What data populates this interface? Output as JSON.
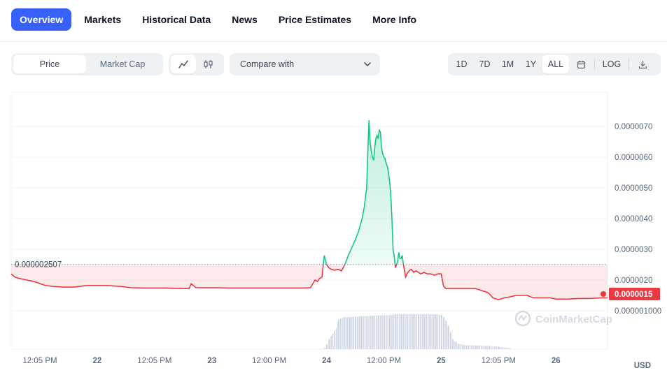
{
  "nav": {
    "tabs": [
      {
        "label": "Overview",
        "active": true
      },
      {
        "label": "Markets"
      },
      {
        "label": "Historical Data"
      },
      {
        "label": "News"
      },
      {
        "label": "Price Estimates"
      },
      {
        "label": "More Info"
      }
    ]
  },
  "toolbar": {
    "metric": {
      "price": "Price",
      "market_cap": "Market Cap",
      "selected": "Price"
    },
    "chart_type": {
      "line_icon": "line-chart-icon",
      "candle_icon": "candlestick-icon",
      "selected": "line"
    },
    "compare": {
      "label": "Compare with",
      "icon": "chevron-down-icon"
    },
    "ranges": [
      "1D",
      "7D",
      "1M",
      "1Y",
      "ALL"
    ],
    "selected_range": "ALL",
    "calendar_icon": "calendar-icon",
    "log_label": "LOG",
    "download_icon": "download-icon"
  },
  "chart_data": {
    "type": "area",
    "ylim": [
      1e-06,
      7.5e-06
    ],
    "y_ticks": [
      "0.0000070",
      "0.0000060",
      "0.0000050",
      "0.0000040",
      "0.0000030",
      "0.0000020",
      "0.000001000"
    ],
    "y_tick_values": [
      7e-06,
      6e-06,
      5e-06,
      4e-06,
      3e-06,
      2e-06,
      1e-06
    ],
    "x_ticks": [
      "12:05 PM",
      "22",
      "12:05 PM",
      "23",
      "12:00 PM",
      "24",
      "12:00 PM",
      "25",
      "12:05 PM",
      "26"
    ],
    "x_tick_positions": [
      0.5,
      1,
      1.5,
      2,
      2.5,
      3,
      3.5,
      4,
      4.5,
      5
    ],
    "x_range": [
      0.25,
      5.45
    ],
    "reference_price": 2.507e-06,
    "reference_label": "0.000002507",
    "current_price": 1.5e-06,
    "current_label": "0.0000015",
    "currency": "USD",
    "watermark": "CoinMarketCap",
    "colors": {
      "up": "#16c784",
      "down": "#ea3943",
      "volume": "#cfd6e4"
    },
    "series": [
      {
        "x": [
          0.25,
          0.28,
          0.32,
          0.36,
          0.45,
          0.55,
          0.62,
          0.7,
          0.8,
          0.9,
          1.0,
          1.1,
          1.2,
          1.3,
          1.4,
          1.5,
          1.6,
          1.7,
          1.8,
          1.82,
          1.86,
          1.95,
          2.05,
          2.15,
          2.3,
          2.45,
          2.6,
          2.7,
          2.8,
          2.86,
          2.9,
          2.92,
          2.94,
          2.96,
          2.98,
          3.0,
          3.02,
          3.04,
          3.07,
          3.1,
          3.13,
          3.16,
          3.19,
          3.22,
          3.25,
          3.28,
          3.31,
          3.33,
          3.35,
          3.36,
          3.37,
          3.38,
          3.39,
          3.4,
          3.41,
          3.42,
          3.43,
          3.44,
          3.45,
          3.46,
          3.47,
          3.48,
          3.49,
          3.5,
          3.51,
          3.52,
          3.53,
          3.54,
          3.55,
          3.56,
          3.57,
          3.58,
          3.59,
          3.6,
          3.61,
          3.62,
          3.63,
          3.64,
          3.65,
          3.66,
          3.67,
          3.68,
          3.69,
          3.7,
          3.72,
          3.74,
          3.76,
          3.78,
          3.8,
          3.82,
          3.85,
          3.88,
          3.91,
          3.94,
          3.97,
          4.0,
          4.02,
          4.04,
          4.06,
          4.1,
          4.2,
          4.3,
          4.4,
          4.42,
          4.45,
          4.5,
          4.55,
          4.6,
          4.65,
          4.7,
          4.75,
          4.8,
          4.85,
          4.9,
          4.95,
          5.0,
          5.1,
          5.2,
          5.3,
          5.4,
          5.45
        ],
        "values": [
          2.2,
          2.1,
          2.05,
          2.02,
          1.95,
          1.82,
          1.79,
          1.77,
          1.77,
          1.82,
          1.82,
          1.82,
          1.79,
          1.75,
          1.74,
          1.74,
          1.74,
          1.73,
          1.72,
          1.88,
          1.75,
          1.75,
          1.75,
          1.74,
          1.74,
          1.74,
          1.74,
          1.74,
          1.74,
          1.75,
          2.0,
          1.95,
          2.05,
          2.1,
          2.8,
          2.5,
          2.4,
          2.35,
          2.32,
          2.35,
          2.3,
          2.5,
          2.8,
          3.05,
          3.3,
          3.6,
          4.0,
          4.4,
          5.0,
          6.2,
          7.2,
          6.5,
          6.2,
          6.0,
          5.9,
          6.3,
          6.6,
          6.7,
          6.6,
          6.9,
          6.8,
          6.3,
          6.1,
          6.0,
          5.95,
          5.8,
          5.7,
          5.5,
          5.2,
          4.8,
          4.0,
          3.0,
          2.8,
          2.4,
          2.5,
          2.6,
          2.9,
          2.7,
          2.7,
          2.8,
          2.5,
          2.3,
          2.1,
          2.2,
          2.3,
          2.35,
          2.25,
          2.3,
          2.25,
          2.2,
          2.25,
          2.2,
          2.2,
          2.15,
          2.2,
          2.2,
          1.8,
          1.72,
          1.72,
          1.72,
          1.72,
          1.72,
          1.6,
          1.55,
          1.42,
          1.36,
          1.42,
          1.45,
          1.5,
          1.5,
          1.5,
          1.42,
          1.42,
          1.42,
          1.42,
          1.38,
          1.38,
          1.4,
          1.4,
          1.42,
          1.42
        ]
      }
    ],
    "volume": {
      "x": [
        2.98,
        3.0,
        3.02,
        3.05,
        3.08,
        3.1,
        3.15,
        3.2,
        3.25,
        3.3,
        3.35,
        3.4,
        3.45,
        3.5,
        3.55,
        3.6,
        3.65,
        3.7,
        3.75,
        3.8,
        3.85,
        3.9,
        3.95,
        4.0,
        4.02,
        4.04,
        4.06,
        4.08,
        4.1,
        4.15,
        4.2,
        4.3,
        4.4,
        4.5,
        4.6
      ],
      "values": [
        0.05,
        0.15,
        0.3,
        0.45,
        0.6,
        0.85,
        0.92,
        0.92,
        0.93,
        0.94,
        0.95,
        0.96,
        0.97,
        0.97,
        0.98,
        1.0,
        1.0,
        1.0,
        1.0,
        1.0,
        1.0,
        1.0,
        1.0,
        0.98,
        0.9,
        0.8,
        0.65,
        0.45,
        0.25,
        0.15,
        0.12,
        0.11,
        0.09,
        0.07,
        0.03
      ]
    }
  }
}
